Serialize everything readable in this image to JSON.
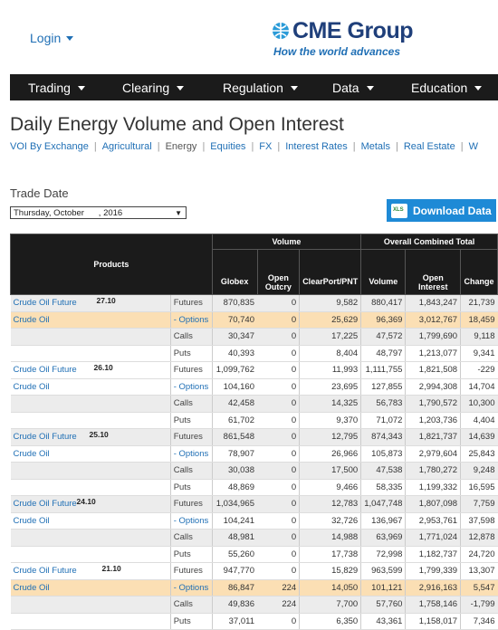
{
  "header": {
    "login_label": "Login",
    "logo_text": "CME Group",
    "logo_tagline": "How the world advances"
  },
  "nav": {
    "items": [
      {
        "label": "Trading"
      },
      {
        "label": "Clearing"
      },
      {
        "label": "Regulation"
      },
      {
        "label": "Data"
      },
      {
        "label": "Education"
      }
    ]
  },
  "page": {
    "title": "Daily Energy Volume and Open Interest",
    "subnav": [
      "VOI By Exchange",
      "Agricultural",
      "Energy",
      "Equities",
      "FX",
      "Interest Rates",
      "Metals",
      "Real Estate",
      "W"
    ],
    "active_subnav": "Energy",
    "trade_date_label": "Trade Date",
    "trade_date_value": "Thursday, October      , 2016",
    "download_label": "Download Data",
    "xls_label": "XLS"
  },
  "table": {
    "headers": {
      "products": "Products",
      "volume": "Volume",
      "oi_total": "Overall Combined Total",
      "globex": "Globex",
      "open_outcry_1": "Open",
      "open_outcry_2": "Outcry",
      "clearport": "ClearPort/PNT",
      "volume_col": "Volume",
      "open_interest_1": "Open",
      "open_interest_2": "Interest",
      "change": "Change"
    },
    "rows": [
      {
        "product": "Crude Oil Future",
        "num": "27.10",
        "type": "Futures",
        "globex": "870,835",
        "outcry": "0",
        "clearport": "9,582",
        "volume": "880,417",
        "oi": "1,843,247",
        "change": "21,739",
        "style": "shade"
      },
      {
        "product": "Crude Oil",
        "num": "",
        "type": "- Options",
        "globex": "70,740",
        "outcry": "0",
        "clearport": "25,629",
        "volume": "96,369",
        "oi": "3,012,767",
        "change": "18,459",
        "style": "hl"
      },
      {
        "product": "",
        "num": "",
        "type": "Calls",
        "globex": "30,347",
        "outcry": "0",
        "clearport": "17,225",
        "volume": "47,572",
        "oi": "1,799,690",
        "change": "9,118",
        "style": "shade"
      },
      {
        "product": "",
        "num": "",
        "type": "Puts",
        "globex": "40,393",
        "outcry": "0",
        "clearport": "8,404",
        "volume": "48,797",
        "oi": "1,213,077",
        "change": "9,341",
        "style": ""
      },
      {
        "product": "Crude Oil Future",
        "num": "26.10",
        "type": "Futures",
        "globex": "1,099,762",
        "outcry": "0",
        "clearport": "11,993",
        "volume": "1,111,755",
        "oi": "1,821,508",
        "change": "-229",
        "style": ""
      },
      {
        "product": "Crude Oil",
        "num": "",
        "type": "- Options",
        "globex": "104,160",
        "outcry": "0",
        "clearport": "23,695",
        "volume": "127,855",
        "oi": "2,994,308",
        "change": "14,704",
        "style": ""
      },
      {
        "product": "",
        "num": "",
        "type": "Calls",
        "globex": "42,458",
        "outcry": "0",
        "clearport": "14,325",
        "volume": "56,783",
        "oi": "1,790,572",
        "change": "10,300",
        "style": "shade"
      },
      {
        "product": "",
        "num": "",
        "type": "Puts",
        "globex": "61,702",
        "outcry": "0",
        "clearport": "9,370",
        "volume": "71,072",
        "oi": "1,203,736",
        "change": "4,404",
        "style": ""
      },
      {
        "product": "Crude Oil Future",
        "num": "25.10",
        "type": "Futures",
        "globex": "861,548",
        "outcry": "0",
        "clearport": "12,795",
        "volume": "874,343",
        "oi": "1,821,737",
        "change": "14,639",
        "style": "shade"
      },
      {
        "product": "Crude Oil",
        "num": "",
        "type": "- Options",
        "globex": "78,907",
        "outcry": "0",
        "clearport": "26,966",
        "volume": "105,873",
        "oi": "2,979,604",
        "change": "25,843",
        "style": ""
      },
      {
        "product": "",
        "num": "",
        "type": "Calls",
        "globex": "30,038",
        "outcry": "0",
        "clearport": "17,500",
        "volume": "47,538",
        "oi": "1,780,272",
        "change": "9,248",
        "style": "shade"
      },
      {
        "product": "",
        "num": "",
        "type": "Puts",
        "globex": "48,869",
        "outcry": "0",
        "clearport": "9,466",
        "volume": "58,335",
        "oi": "1,199,332",
        "change": "16,595",
        "style": ""
      },
      {
        "product": "Crude Oil Future",
        "num": "24.10",
        "type": "Futures",
        "globex": "1,034,965",
        "outcry": "0",
        "clearport": "12,783",
        "volume": "1,047,748",
        "oi": "1,807,098",
        "change": "7,759",
        "style": "shade"
      },
      {
        "product": "Crude Oil",
        "num": "",
        "type": "- Options",
        "globex": "104,241",
        "outcry": "0",
        "clearport": "32,726",
        "volume": "136,967",
        "oi": "2,953,761",
        "change": "37,598",
        "style": ""
      },
      {
        "product": "",
        "num": "",
        "type": "Calls",
        "globex": "48,981",
        "outcry": "0",
        "clearport": "14,988",
        "volume": "63,969",
        "oi": "1,771,024",
        "change": "12,878",
        "style": "shade"
      },
      {
        "product": "",
        "num": "",
        "type": "Puts",
        "globex": "55,260",
        "outcry": "0",
        "clearport": "17,738",
        "volume": "72,998",
        "oi": "1,182,737",
        "change": "24,720",
        "style": ""
      },
      {
        "product": "Crude Oil Future",
        "num": "21.10",
        "type": "Futures",
        "globex": "947,770",
        "outcry": "0",
        "clearport": "15,829",
        "volume": "963,599",
        "oi": "1,799,339",
        "change": "13,307",
        "style": ""
      },
      {
        "product": "Crude Oil",
        "num": "",
        "type": "- Options",
        "globex": "86,847",
        "outcry": "224",
        "clearport": "14,050",
        "volume": "101,121",
        "oi": "2,916,163",
        "change": "5,547",
        "style": "hl"
      },
      {
        "product": "",
        "num": "",
        "type": "Calls",
        "globex": "49,836",
        "outcry": "224",
        "clearport": "7,700",
        "volume": "57,760",
        "oi": "1,758,146",
        "change": "-1,799",
        "style": "shade"
      },
      {
        "product": "",
        "num": "",
        "type": "Puts",
        "globex": "37,011",
        "outcry": "0",
        "clearport": "6,350",
        "volume": "43,361",
        "oi": "1,158,017",
        "change": "7,346",
        "style": ""
      }
    ]
  },
  "colors": {
    "brand_blue": "#1f6fb5",
    "nav_bg": "#1b1b1b",
    "highlight_row": "#fbdfb4",
    "shade_row": "#ececec",
    "download_btn": "#1e8ad6"
  }
}
